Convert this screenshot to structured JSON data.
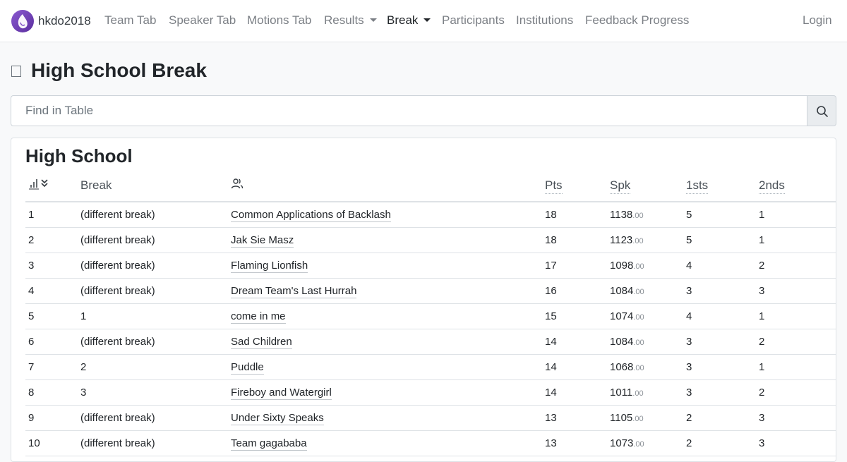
{
  "nav": {
    "brand": "hkdo2018",
    "items": [
      {
        "label": "Team Tab"
      },
      {
        "label": "Speaker Tab"
      },
      {
        "label": "Motions Tab"
      },
      {
        "label": "Results"
      },
      {
        "label": "Break"
      },
      {
        "label": "Participants"
      },
      {
        "label": "Institutions"
      },
      {
        "label": "Feedback Progress"
      }
    ],
    "login": "Login"
  },
  "page": {
    "title": "High School Break"
  },
  "search": {
    "placeholder": "Find in Table"
  },
  "table": {
    "title": "High School",
    "columns": {
      "break": "Break",
      "pts": "Pts",
      "spk": "Spk",
      "firsts": "1sts",
      "seconds": "2nds"
    },
    "rows": [
      {
        "rank": "1",
        "break": "(different break)",
        "team": "Common Applications of Backlash",
        "pts": "18",
        "spk": "1138",
        "spk_dec": ".00",
        "firsts": "5",
        "seconds": "1"
      },
      {
        "rank": "2",
        "break": "(different break)",
        "team": "Jak Sie Masz",
        "pts": "18",
        "spk": "1123",
        "spk_dec": ".00",
        "firsts": "5",
        "seconds": "1"
      },
      {
        "rank": "3",
        "break": "(different break)",
        "team": "Flaming Lionfish",
        "pts": "17",
        "spk": "1098",
        "spk_dec": ".00",
        "firsts": "4",
        "seconds": "2"
      },
      {
        "rank": "4",
        "break": "(different break)",
        "team": "Dream Team's Last Hurrah",
        "pts": "16",
        "spk": "1084",
        "spk_dec": ".00",
        "firsts": "3",
        "seconds": "3"
      },
      {
        "rank": "5",
        "break": "1",
        "team": "come in me",
        "pts": "15",
        "spk": "1074",
        "spk_dec": ".00",
        "firsts": "4",
        "seconds": "1"
      },
      {
        "rank": "6",
        "break": "(different break)",
        "team": "Sad Children",
        "pts": "14",
        "spk": "1084",
        "spk_dec": ".00",
        "firsts": "3",
        "seconds": "2"
      },
      {
        "rank": "7",
        "break": "2",
        "team": "Puddle",
        "pts": "14",
        "spk": "1068",
        "spk_dec": ".00",
        "firsts": "3",
        "seconds": "1"
      },
      {
        "rank": "8",
        "break": "3",
        "team": "Fireboy and Watergirl",
        "pts": "14",
        "spk": "1011",
        "spk_dec": ".00",
        "firsts": "3",
        "seconds": "2"
      },
      {
        "rank": "9",
        "break": "(different break)",
        "team": "Under Sixty Speaks",
        "pts": "13",
        "spk": "1105",
        "spk_dec": ".00",
        "firsts": "2",
        "seconds": "3"
      },
      {
        "rank": "10",
        "break": "(different break)",
        "team": "Team gagababa",
        "pts": "13",
        "spk": "1073",
        "spk_dec": ".00",
        "firsts": "2",
        "seconds": "3"
      }
    ]
  }
}
